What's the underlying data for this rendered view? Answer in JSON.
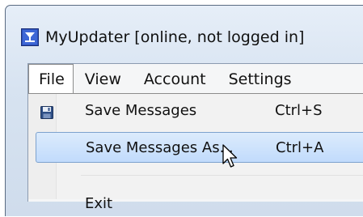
{
  "window": {
    "title": "MyUpdater [online, not logged in]",
    "icon": "app-logo-icon"
  },
  "menubar": {
    "items": [
      {
        "label": "File"
      },
      {
        "label": "View"
      },
      {
        "label": "Account"
      },
      {
        "label": "Settings"
      }
    ]
  },
  "file_menu": {
    "items": [
      {
        "label": "Save Messages",
        "shortcut": "Ctrl+S",
        "icon": "floppy-disk-icon"
      },
      {
        "label": "Save Messages As...",
        "shortcut": "Ctrl+A"
      },
      {
        "label": "Exit"
      }
    ]
  },
  "colors": {
    "highlight": "#c1dbfc",
    "highlight_border": "#7da2ce"
  }
}
